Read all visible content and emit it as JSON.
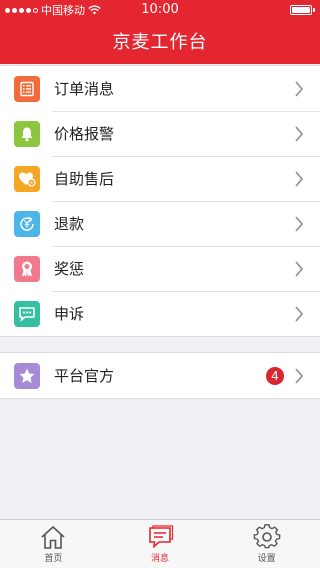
{
  "status": {
    "carrier": "中国移动",
    "time": "10:00"
  },
  "header": {
    "title": "京麦工作台"
  },
  "menu": [
    {
      "label": "订单消息",
      "icon": "order-list-icon",
      "color": "#f26b3a"
    },
    {
      "label": "价格报警",
      "icon": "bell-icon",
      "color": "#8cc63f"
    },
    {
      "label": "自助售后",
      "icon": "heart-icon",
      "color": "#f5a623"
    },
    {
      "label": "退款",
      "icon": "refund-yen-icon",
      "color": "#4db6e8"
    },
    {
      "label": "奖惩",
      "icon": "award-ribbon-icon",
      "color": "#f07a8c"
    },
    {
      "label": "申诉",
      "icon": "chat-bubble-icon",
      "color": "#34c0a0"
    }
  ],
  "official": {
    "label": "平台官方",
    "icon": "star-icon",
    "color": "#a78bd6",
    "badge": "4"
  },
  "tabs": [
    {
      "label": "首页",
      "icon": "home-icon",
      "active": false
    },
    {
      "label": "消息",
      "icon": "message-icon",
      "active": true
    },
    {
      "label": "设置",
      "icon": "gear-icon",
      "active": false
    }
  ]
}
